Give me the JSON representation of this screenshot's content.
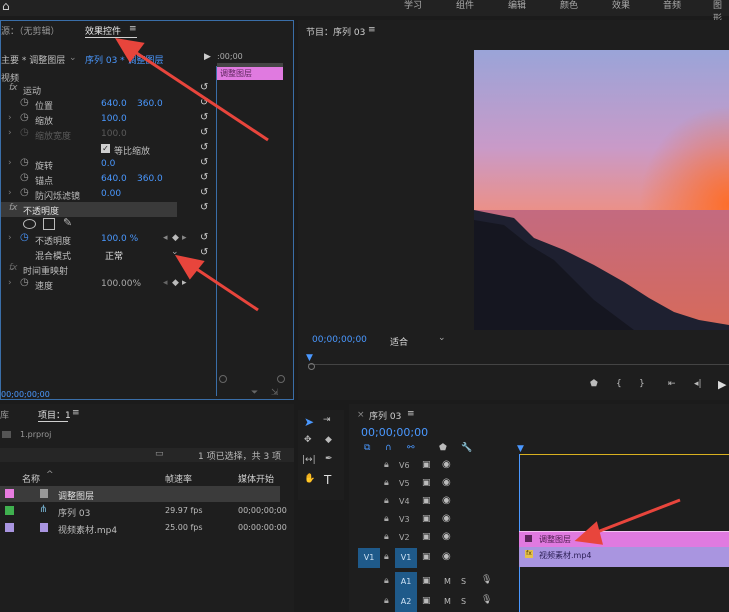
{
  "topbar": {
    "home_icon": "home-icon",
    "tabs": [
      "学习",
      "组件",
      "编辑",
      "颜色",
      "效果",
      "音频",
      "图形"
    ]
  },
  "source_panel": {
    "tab_source": "源：（无剪辑）",
    "tab_effect_controls": "效果控件",
    "menu_glyph": "≡",
    "master": "主要 * 调整图层",
    "sequence": "序列 03 * 调整图层",
    "timecode_start": ":00;00",
    "clip_label": "调整图层",
    "section_video": "视频",
    "motion": "运动",
    "position_label": "位置",
    "position_x": "640.0",
    "position_y": "360.0",
    "scale_label": "缩放",
    "scale_val": "100.0",
    "scale_width_label": "缩放宽度",
    "scale_width_val": "100.0",
    "uniform_scale": "等比缩放",
    "rotation_label": "旋转",
    "rotation_val": "0.0",
    "anchor_label": "锚点",
    "anchor_x": "640.0",
    "anchor_y": "360.0",
    "antiflicker_label": "防闪烁滤镜",
    "antiflicker_val": "0.00",
    "opacity_section": "不透明度",
    "opacity_label": "不透明度",
    "opacity_val": "100.0 %",
    "blend_label": "混合模式",
    "blend_val": "正常",
    "time_remap": "时间重映射",
    "speed_label": "速度",
    "speed_val": "100.00%",
    "bottom_timecode": "00;00;00;00"
  },
  "program_panel": {
    "title": "节目：序列 03",
    "menu_glyph": "≡",
    "timecode": "00;00;00;00",
    "fit": "适合"
  },
  "project_panel": {
    "tab_library": "库",
    "tab_project": "项目：1",
    "menu_glyph": "≡",
    "file": "1.prproj",
    "selection_info": "1 项已选择，共 3 项",
    "col_name": "名称",
    "col_fps": "帧速率",
    "col_start": "媒体开始",
    "items": [
      {
        "name": "调整图层",
        "fps": "",
        "start": "",
        "color": "#e87ce0",
        "icon": "adjustment-layer-icon"
      },
      {
        "name": "序列 03",
        "fps": "29.97 fps",
        "start": "00;00;00;00",
        "color": "#3fb04f",
        "icon": "sequence-icon"
      },
      {
        "name": "视频素材.mp4",
        "fps": "25.00 fps",
        "start": "00:00:00:00",
        "color": "#a995e0",
        "icon": "video-clip-icon"
      }
    ]
  },
  "timeline_panel": {
    "title": "序列 03",
    "menu_glyph": "≡",
    "timecode": "00;00;00;00",
    "tracks": [
      {
        "name": "V6",
        "type": "video"
      },
      {
        "name": "V5",
        "type": "video"
      },
      {
        "name": "V4",
        "type": "video"
      },
      {
        "name": "V3",
        "type": "video"
      },
      {
        "name": "V2",
        "type": "video"
      },
      {
        "name": "V1",
        "type": "video"
      },
      {
        "name": "A1",
        "type": "audio"
      },
      {
        "name": "A2",
        "type": "audio"
      }
    ],
    "src_v1": "V1",
    "clip_v2": "调整图层",
    "clip_v1": "视频素材.mp4",
    "audio_m": "M",
    "audio_s": "S"
  },
  "colors": {
    "accent": "#4a98ff",
    "adjustment": "#e87ce0",
    "video_clip": "#a995e0",
    "arrow": "#e8453c"
  }
}
